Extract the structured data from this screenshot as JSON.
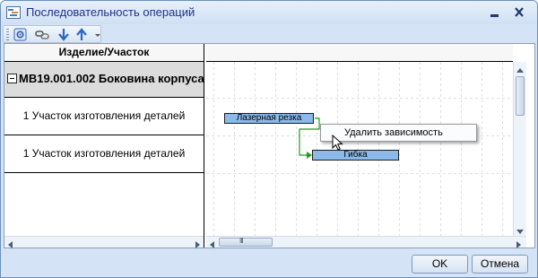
{
  "window": {
    "title": "Последовательность операций",
    "icon": "gantt-app-icon"
  },
  "toolbar": {
    "buttons": [
      {
        "name": "settings",
        "icon": "settings-icon"
      },
      {
        "name": "link",
        "icon": "link-icon"
      },
      {
        "name": "move-down",
        "icon": "arrow-down-icon"
      },
      {
        "name": "move-up",
        "icon": "arrow-up-icon"
      },
      {
        "name": "more",
        "icon": "chevron-down-icon"
      }
    ]
  },
  "left_pane": {
    "header": "Изделие/Участок",
    "group": {
      "label": "МВ19.001.002 Боковина корпуса",
      "expanded": true
    },
    "rows": [
      {
        "label": "1 Участок изготовления деталей"
      },
      {
        "label": "1 Участок изготовления деталей"
      }
    ]
  },
  "timeline": {
    "tasks": [
      {
        "label": "Лазерная резка"
      },
      {
        "label": "Гибка"
      }
    ],
    "context_menu": {
      "items": [
        {
          "label": "Удалить зависимость"
        }
      ]
    }
  },
  "footer": {
    "ok_label": "OK",
    "cancel_label": "Отмена"
  },
  "colors": {
    "task_bar": "#8ab9ea",
    "dependency_line": "#1e9e1e",
    "title_text": "#1e3287"
  }
}
